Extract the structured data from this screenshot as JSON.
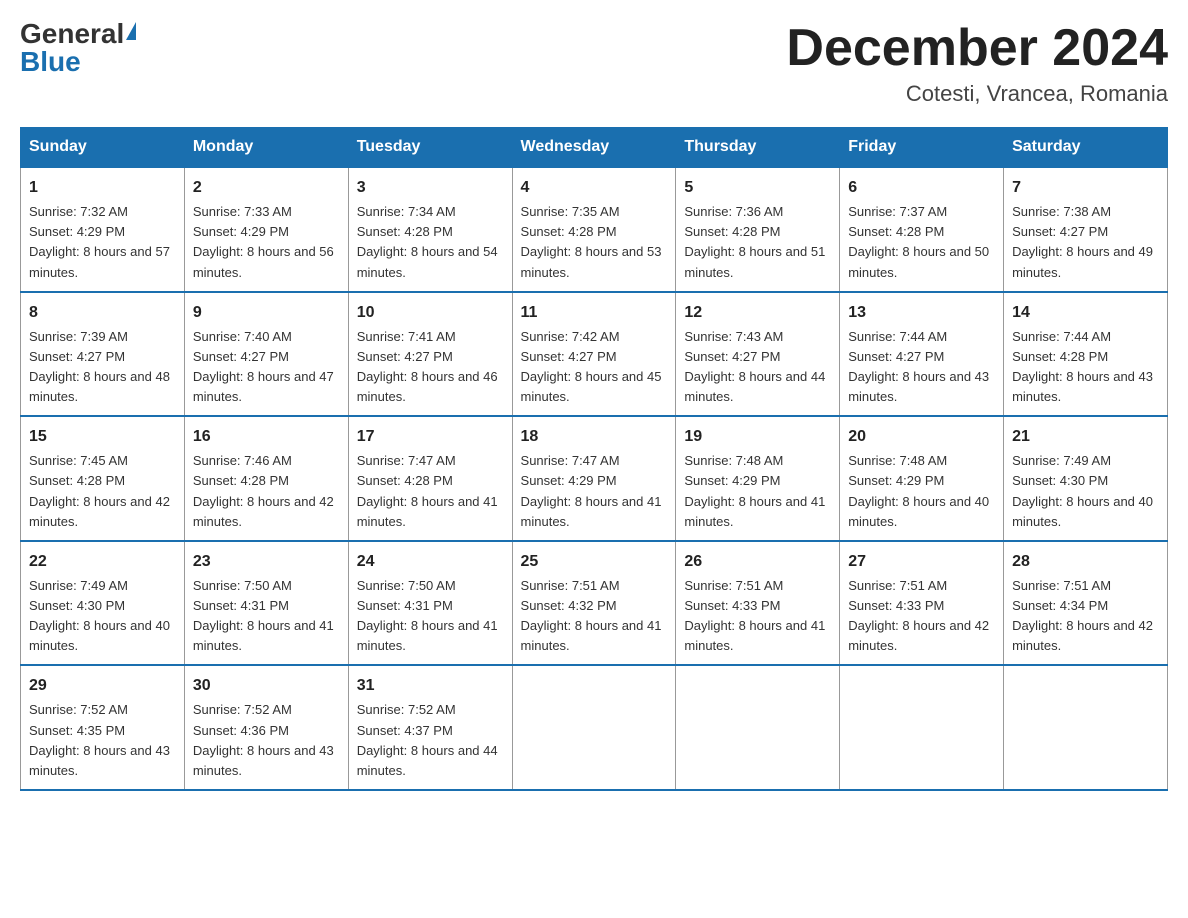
{
  "header": {
    "logo_general": "General",
    "logo_blue": "Blue",
    "month_title": "December 2024",
    "location": "Cotesti, Vrancea, Romania"
  },
  "days_of_week": [
    "Sunday",
    "Monday",
    "Tuesday",
    "Wednesday",
    "Thursday",
    "Friday",
    "Saturday"
  ],
  "weeks": [
    [
      {
        "day": "1",
        "sunrise": "7:32 AM",
        "sunset": "4:29 PM",
        "daylight": "8 hours and 57 minutes."
      },
      {
        "day": "2",
        "sunrise": "7:33 AM",
        "sunset": "4:29 PM",
        "daylight": "8 hours and 56 minutes."
      },
      {
        "day": "3",
        "sunrise": "7:34 AM",
        "sunset": "4:28 PM",
        "daylight": "8 hours and 54 minutes."
      },
      {
        "day": "4",
        "sunrise": "7:35 AM",
        "sunset": "4:28 PM",
        "daylight": "8 hours and 53 minutes."
      },
      {
        "day": "5",
        "sunrise": "7:36 AM",
        "sunset": "4:28 PM",
        "daylight": "8 hours and 51 minutes."
      },
      {
        "day": "6",
        "sunrise": "7:37 AM",
        "sunset": "4:28 PM",
        "daylight": "8 hours and 50 minutes."
      },
      {
        "day": "7",
        "sunrise": "7:38 AM",
        "sunset": "4:27 PM",
        "daylight": "8 hours and 49 minutes."
      }
    ],
    [
      {
        "day": "8",
        "sunrise": "7:39 AM",
        "sunset": "4:27 PM",
        "daylight": "8 hours and 48 minutes."
      },
      {
        "day": "9",
        "sunrise": "7:40 AM",
        "sunset": "4:27 PM",
        "daylight": "8 hours and 47 minutes."
      },
      {
        "day": "10",
        "sunrise": "7:41 AM",
        "sunset": "4:27 PM",
        "daylight": "8 hours and 46 minutes."
      },
      {
        "day": "11",
        "sunrise": "7:42 AM",
        "sunset": "4:27 PM",
        "daylight": "8 hours and 45 minutes."
      },
      {
        "day": "12",
        "sunrise": "7:43 AM",
        "sunset": "4:27 PM",
        "daylight": "8 hours and 44 minutes."
      },
      {
        "day": "13",
        "sunrise": "7:44 AM",
        "sunset": "4:27 PM",
        "daylight": "8 hours and 43 minutes."
      },
      {
        "day": "14",
        "sunrise": "7:44 AM",
        "sunset": "4:28 PM",
        "daylight": "8 hours and 43 minutes."
      }
    ],
    [
      {
        "day": "15",
        "sunrise": "7:45 AM",
        "sunset": "4:28 PM",
        "daylight": "8 hours and 42 minutes."
      },
      {
        "day": "16",
        "sunrise": "7:46 AM",
        "sunset": "4:28 PM",
        "daylight": "8 hours and 42 minutes."
      },
      {
        "day": "17",
        "sunrise": "7:47 AM",
        "sunset": "4:28 PM",
        "daylight": "8 hours and 41 minutes."
      },
      {
        "day": "18",
        "sunrise": "7:47 AM",
        "sunset": "4:29 PM",
        "daylight": "8 hours and 41 minutes."
      },
      {
        "day": "19",
        "sunrise": "7:48 AM",
        "sunset": "4:29 PM",
        "daylight": "8 hours and 41 minutes."
      },
      {
        "day": "20",
        "sunrise": "7:48 AM",
        "sunset": "4:29 PM",
        "daylight": "8 hours and 40 minutes."
      },
      {
        "day": "21",
        "sunrise": "7:49 AM",
        "sunset": "4:30 PM",
        "daylight": "8 hours and 40 minutes."
      }
    ],
    [
      {
        "day": "22",
        "sunrise": "7:49 AM",
        "sunset": "4:30 PM",
        "daylight": "8 hours and 40 minutes."
      },
      {
        "day": "23",
        "sunrise": "7:50 AM",
        "sunset": "4:31 PM",
        "daylight": "8 hours and 41 minutes."
      },
      {
        "day": "24",
        "sunrise": "7:50 AM",
        "sunset": "4:31 PM",
        "daylight": "8 hours and 41 minutes."
      },
      {
        "day": "25",
        "sunrise": "7:51 AM",
        "sunset": "4:32 PM",
        "daylight": "8 hours and 41 minutes."
      },
      {
        "day": "26",
        "sunrise": "7:51 AM",
        "sunset": "4:33 PM",
        "daylight": "8 hours and 41 minutes."
      },
      {
        "day": "27",
        "sunrise": "7:51 AM",
        "sunset": "4:33 PM",
        "daylight": "8 hours and 42 minutes."
      },
      {
        "day": "28",
        "sunrise": "7:51 AM",
        "sunset": "4:34 PM",
        "daylight": "8 hours and 42 minutes."
      }
    ],
    [
      {
        "day": "29",
        "sunrise": "7:52 AM",
        "sunset": "4:35 PM",
        "daylight": "8 hours and 43 minutes."
      },
      {
        "day": "30",
        "sunrise": "7:52 AM",
        "sunset": "4:36 PM",
        "daylight": "8 hours and 43 minutes."
      },
      {
        "day": "31",
        "sunrise": "7:52 AM",
        "sunset": "4:37 PM",
        "daylight": "8 hours and 44 minutes."
      },
      null,
      null,
      null,
      null
    ]
  ]
}
